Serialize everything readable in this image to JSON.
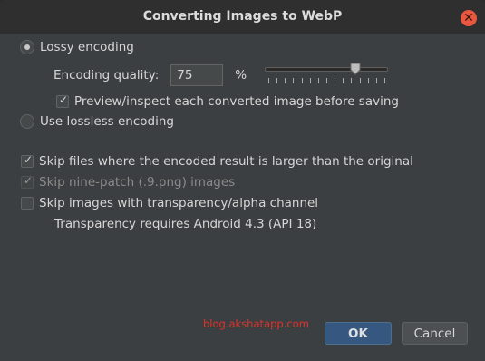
{
  "dialog": {
    "title": "Converting Images to WebP",
    "close_icon": "close-icon"
  },
  "encoding": {
    "lossy_label": "Lossy encoding",
    "lossy_selected": true,
    "quality_label": "Encoding quality:",
    "quality_value": "75",
    "quality_unit": "%",
    "quality_slider_fraction": 0.75,
    "preview_label": "Preview/inspect each converted image before saving",
    "preview_checked": true,
    "lossless_label": "Use lossless encoding",
    "lossless_selected": false
  },
  "options": {
    "skip_larger_label": "Skip files where the encoded result is larger than the original",
    "skip_larger_checked": true,
    "skip_ninepatch_label": "Skip nine-patch (.9.png) images",
    "skip_ninepatch_checked": true,
    "skip_transparency_label": "Skip images with transparency/alpha channel",
    "skip_transparency_checked": false,
    "transparency_note": "Transparency requires Android 4.3 (API 18)"
  },
  "footer": {
    "watermark": "blog.akshatapp.com",
    "ok_label": "OK",
    "cancel_label": "Cancel"
  },
  "colors": {
    "accent": "#365880",
    "close": "#e9573f",
    "watermark": "#e0322c"
  }
}
